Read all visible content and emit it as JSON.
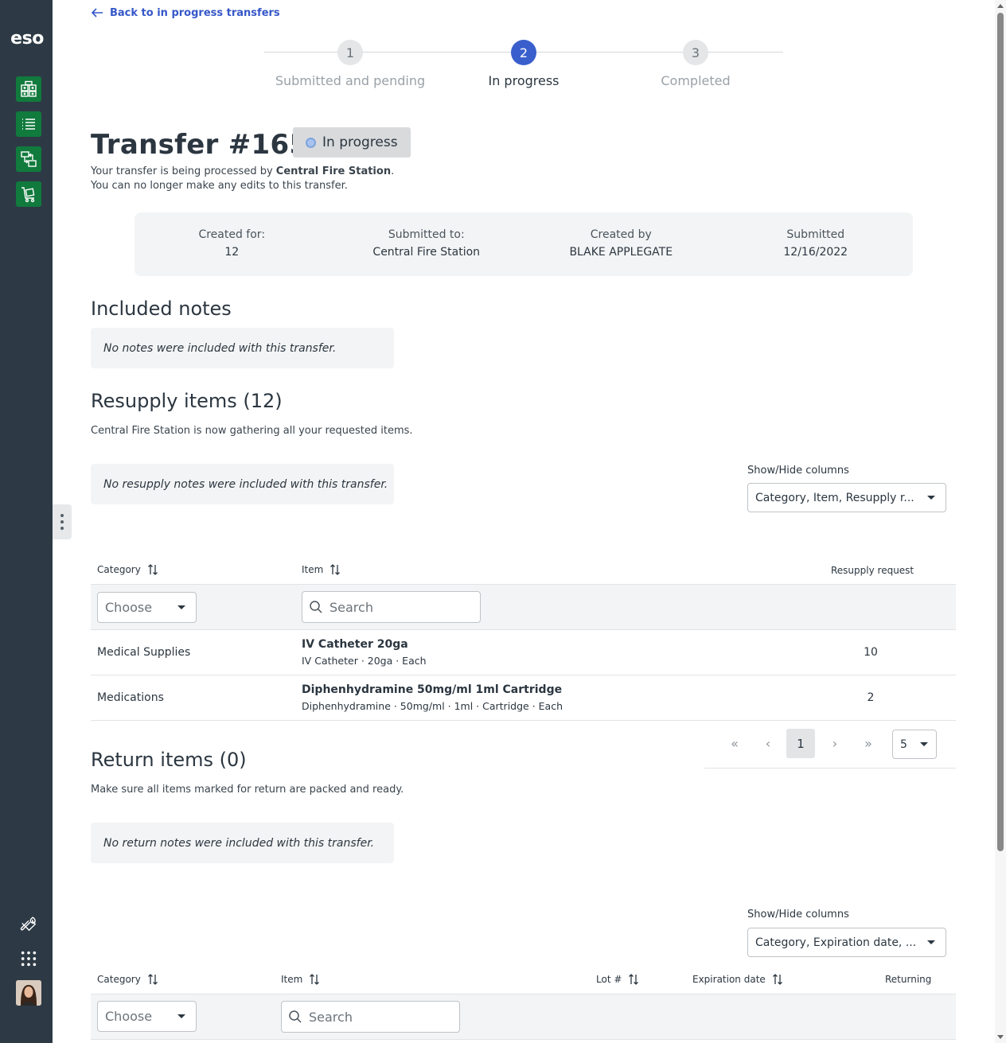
{
  "app": {
    "logo_text": "eso",
    "nav_icons": [
      "inventory-grid-icon",
      "list-icon",
      "transfer-icon",
      "cart-icon"
    ],
    "tool_icons": [
      "wrench-icon",
      "apps-grid-icon"
    ],
    "accent": "#117a3d",
    "sidebar_bg": "#2d3a45"
  },
  "back_link": "Back to in progress transfers",
  "stepper": {
    "steps": [
      {
        "num": "1",
        "label": "Submitted and pending"
      },
      {
        "num": "2",
        "label": "In progress"
      },
      {
        "num": "3",
        "label": "Completed"
      }
    ],
    "active_index": 2,
    "active_color": "#3a5fcd"
  },
  "transfer": {
    "title": "Transfer #1654",
    "status": "In progress",
    "desc_prefix": "Your transfer is being processed by ",
    "desc_station": "Central Fire Station",
    "desc_suffix": ".",
    "desc_line2": "You can no longer make any edits to this transfer."
  },
  "summary": [
    {
      "key": "Created for:",
      "value": "12"
    },
    {
      "key": "Submitted to:",
      "value": "Central Fire Station"
    },
    {
      "key": "Created by",
      "value": "BLAKE APPLEGATE"
    },
    {
      "key": "Submitted",
      "value": "12/16/2022"
    }
  ],
  "notes": {
    "heading": "Included notes",
    "empty": "No notes were included with this transfer."
  },
  "resupply": {
    "heading": "Resupply items (12)",
    "desc": "Central Fire Station is now gathering all your requested items.",
    "notes_empty": "No resupply notes were included with this transfer.",
    "show_hide_label": "Show/Hide columns",
    "show_hide_value": "Category, Item, Resupply r...",
    "columns": {
      "category": "Category",
      "item": "Item",
      "request": "Resupply request"
    },
    "category_placeholder": "Choose",
    "search_placeholder": "Search",
    "rows": [
      {
        "category": "Medical Supplies",
        "item": "IV Catheter 20ga",
        "detail": "IV Catheter · 20ga · Each",
        "qty": "10"
      },
      {
        "category": "Medications",
        "item": "Diphenhydramine 50mg/ml 1ml Cartridge",
        "detail": "Diphenhydramine · 50mg/ml · 1ml · Cartridge · Each",
        "qty": "2"
      }
    ],
    "pager": {
      "first": "«",
      "prev": "‹",
      "page": "1",
      "next": "›",
      "last": "»",
      "page_size": "5"
    }
  },
  "returns": {
    "heading": "Return items (0)",
    "desc": "Make sure all items marked for return are packed and ready.",
    "notes_empty": "No return notes were included with this transfer.",
    "show_hide_label": "Show/Hide columns",
    "show_hide_value": "Category, Expiration date, ...",
    "columns": {
      "category": "Category",
      "item": "Item",
      "lot": "Lot #",
      "expiration": "Expiration date",
      "returning": "Returning"
    },
    "category_placeholder": "Choose",
    "search_placeholder": "Search"
  }
}
